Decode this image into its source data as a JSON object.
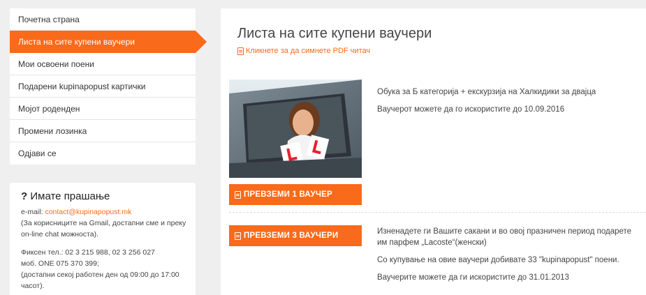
{
  "sidebar": {
    "items": [
      {
        "label": "Почетна страна"
      },
      {
        "label": "Листа на сите купени ваучери",
        "active": true
      },
      {
        "label": "Мои освоени поени"
      },
      {
        "label": "Подарени kupinapopust картички"
      },
      {
        "label": "Мојот роденден"
      },
      {
        "label": "Промени лозинка"
      },
      {
        "label": "Одјави се"
      }
    ]
  },
  "help": {
    "title_mark": "?",
    "title": "Имате прашање",
    "email_label": "e-mail:",
    "email": "contact@kupinapopust.mk",
    "gmail_note": "(За корисниците на Gmail, достапни сме и преку on-line chat можноста).",
    "phone_line": "Фиксен тел.: 02 3 215 988, 02 3 256 027",
    "mobile_line": "моб. ONE 075 370 399;",
    "hours_line": "(достапни секој работен ден од 09:00 до 17:00 часот)."
  },
  "main": {
    "title": "Листа на сите купени ваучери",
    "pdf_link": "Кликнете за да симнете PDF читач"
  },
  "vouchers": [
    {
      "button": "ПРЕВЗЕМИ 1 ВАУЧЕР",
      "lines": [
        "Обука за Б категорија + екскурзија на Халкидики за двајца",
        "Ваучерот можете да го искористите до 10.09.2016"
      ]
    },
    {
      "button": "ПРЕВЗЕМИ 3 ВАУЧЕРИ",
      "lines": [
        "Изненадете ги Вашите сакани и во овој празничен период подарете им парфем „Lacoste“(женски)",
        "Со купување на овие ваучери добивате 33 \"kupinapopust\" поени.",
        "Ваучерите можете да ги искористите до 31.01.2013"
      ]
    }
  ],
  "colors": {
    "accent": "#f96a1a",
    "background": "#efefef"
  }
}
